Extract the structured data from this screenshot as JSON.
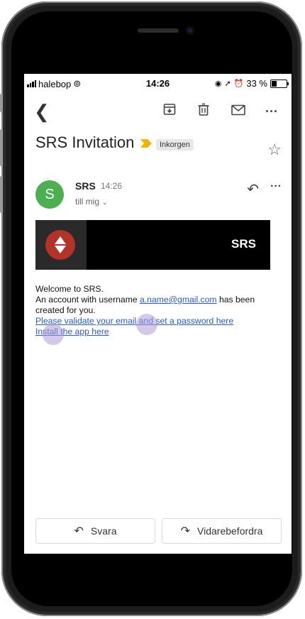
{
  "status_bar": {
    "carrier": "halebop",
    "time": "14:26",
    "battery": "33 %"
  },
  "email": {
    "subject": "SRS Invitation",
    "label_chip": "Inkorgen",
    "sender_initial": "S",
    "sender_name": "SRS",
    "sent_time": "14:26",
    "recipient": "till mig",
    "banner_text": "SRS",
    "body_line1": "Welcome to SRS.",
    "body_line2_prefix": "An account with username",
    "email_link": "a.name@gmail.com",
    "body_line2_suffix": "has been",
    "body_line3": "created for you.",
    "validate_link": "Please validate your email and set a password here",
    "install_link": "Install the app here"
  },
  "actions": {
    "reply": "Svara",
    "forward": "Vidarebefordra"
  },
  "colors": {
    "avatar": "#4caf50",
    "link": "#2a5ad7",
    "label_arrow": "#f5b400",
    "logo": "#b3322a"
  },
  "icons": [
    "back-icon",
    "archive-icon",
    "delete-icon",
    "mail-icon",
    "more-icon",
    "star-icon",
    "reply-icon",
    "forward-icon"
  ]
}
